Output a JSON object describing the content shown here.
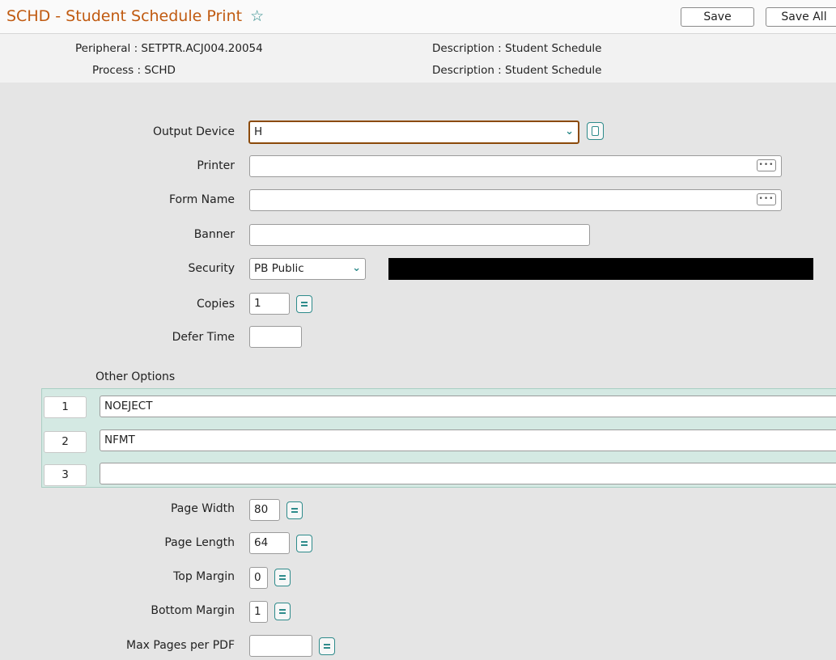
{
  "header": {
    "title": "SCHD - Student Schedule Print",
    "favorite_icon": "star-outline-icon",
    "save_label": "Save",
    "save_all_label": "Save All"
  },
  "info": {
    "peripheral": "Peripheral : SETPTR.ACJ004.20054",
    "process": "Process : SCHD",
    "description1": "Description : Student Schedule",
    "description2": "Description : Student Schedule"
  },
  "form": {
    "output_device": {
      "label": "Output Device",
      "value": "H"
    },
    "printer": {
      "label": "Printer",
      "value": ""
    },
    "form_name": {
      "label": "Form Name",
      "value": ""
    },
    "banner": {
      "label": "Banner",
      "value": ""
    },
    "security": {
      "label": "Security",
      "value": "PB Public",
      "redacted_color": "#000000"
    },
    "copies": {
      "label": "Copies",
      "value": "1"
    },
    "defer_time": {
      "label": "Defer Time",
      "value": ""
    },
    "other_options": {
      "label": "Other Options",
      "rows": [
        {
          "num": "1",
          "value": "NOEJECT"
        },
        {
          "num": "2",
          "value": "NFMT"
        },
        {
          "num": "3",
          "value": ""
        }
      ]
    },
    "page_width": {
      "label": "Page Width",
      "value": "80"
    },
    "page_length": {
      "label": "Page Length",
      "value": "64"
    },
    "top_margin": {
      "label": "Top Margin",
      "value": "0"
    },
    "bottom_margin": {
      "label": "Bottom Margin",
      "value": "1"
    },
    "max_pages": {
      "label": "Max Pages per PDF",
      "value": ""
    }
  },
  "colors": {
    "title": "#c05a10",
    "accent": "#2e8b8b",
    "focus_border": "#8b4a0a",
    "options_bg": "#d4e9e3"
  }
}
